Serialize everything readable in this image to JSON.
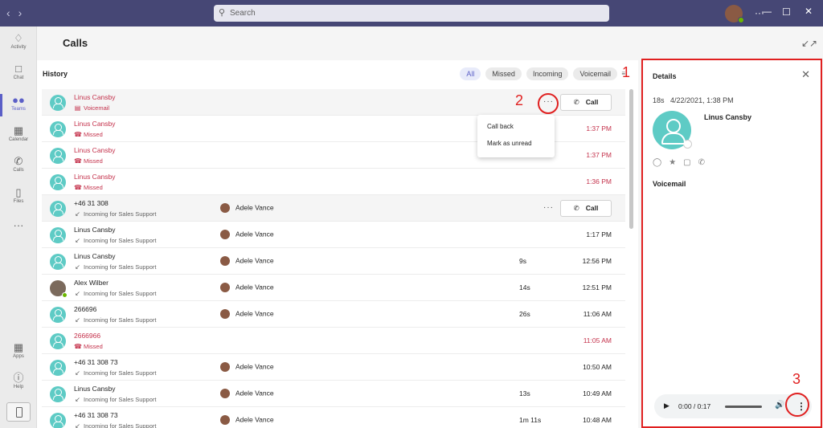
{
  "titlebar": {
    "search_placeholder": "Search"
  },
  "rail": [
    {
      "label": "Activity",
      "icon": "bell-icon"
    },
    {
      "label": "Chat",
      "icon": "chat-icon"
    },
    {
      "label": "Teams",
      "icon": "teams-icon"
    },
    {
      "label": "Calendar",
      "icon": "calendar-icon"
    },
    {
      "label": "Calls",
      "icon": "phone-icon"
    },
    {
      "label": "Files",
      "icon": "file-icon"
    },
    {
      "label": "Apps",
      "icon": "apps-icon"
    },
    {
      "label": "Help",
      "icon": "help-icon"
    }
  ],
  "page": {
    "title": "Calls"
  },
  "history": {
    "title": "History",
    "filters": [
      "All",
      "Missed",
      "Incoming",
      "Voicemail"
    ],
    "call_label": "Call",
    "context_menu": [
      "Call back",
      "Mark as unread"
    ],
    "rows": [
      {
        "name": "Linus Cansby",
        "sub": "Voicemail",
        "with": "",
        "duration": "",
        "time": "",
        "missed": true
      },
      {
        "name": "Linus Cansby",
        "sub": "Missed",
        "with": "",
        "duration": "",
        "time": "1:37 PM",
        "missed": true
      },
      {
        "name": "Linus Cansby",
        "sub": "Missed",
        "with": "",
        "duration": "",
        "time": "1:37 PM",
        "missed": true
      },
      {
        "name": "Linus Cansby",
        "sub": "Missed",
        "with": "",
        "duration": "",
        "time": "1:36 PM",
        "missed": true
      },
      {
        "name": "+46 31 308",
        "sub": "Incoming for Sales Support",
        "with": "Adele Vance",
        "duration": "",
        "time": "",
        "missed": false
      },
      {
        "name": "Linus Cansby",
        "sub": "Incoming for Sales Support",
        "with": "Adele Vance",
        "duration": "",
        "time": "1:17 PM",
        "missed": false
      },
      {
        "name": "Linus Cansby",
        "sub": "Incoming for Sales Support",
        "with": "Adele Vance",
        "duration": "9s",
        "time": "12:56 PM",
        "missed": false
      },
      {
        "name": "Alex Wilber",
        "sub": "Incoming for Sales Support",
        "with": "Adele Vance",
        "duration": "14s",
        "time": "12:51 PM",
        "missed": false
      },
      {
        "name": "266696",
        "sub": "Incoming for Sales Support",
        "with": "Adele Vance",
        "duration": "26s",
        "time": "11:06 AM",
        "missed": false
      },
      {
        "name": "2666966",
        "sub": "Missed",
        "with": "",
        "duration": "",
        "time": "11:05 AM",
        "missed": true
      },
      {
        "name": "+46 31 308 73",
        "sub": "Incoming for Sales Support",
        "with": "Adele Vance",
        "duration": "",
        "time": "10:50 AM",
        "missed": false
      },
      {
        "name": "Linus Cansby",
        "sub": "Incoming for Sales Support",
        "with": "Adele Vance",
        "duration": "13s",
        "time": "10:49 AM",
        "missed": false
      },
      {
        "name": "+46 31 308 73",
        "sub": "Incoming for Sales Support",
        "with": "Adele Vance",
        "duration": "1m 11s",
        "time": "10:48 AM",
        "missed": false
      }
    ]
  },
  "details": {
    "title": "Details",
    "duration": "18s",
    "datetime": "4/22/2021, 1:38 PM",
    "name": "Linus Cansby",
    "section": "Voicemail",
    "player_time": "0:00 / 0:17"
  },
  "annotations": [
    "1",
    "2",
    "3"
  ]
}
